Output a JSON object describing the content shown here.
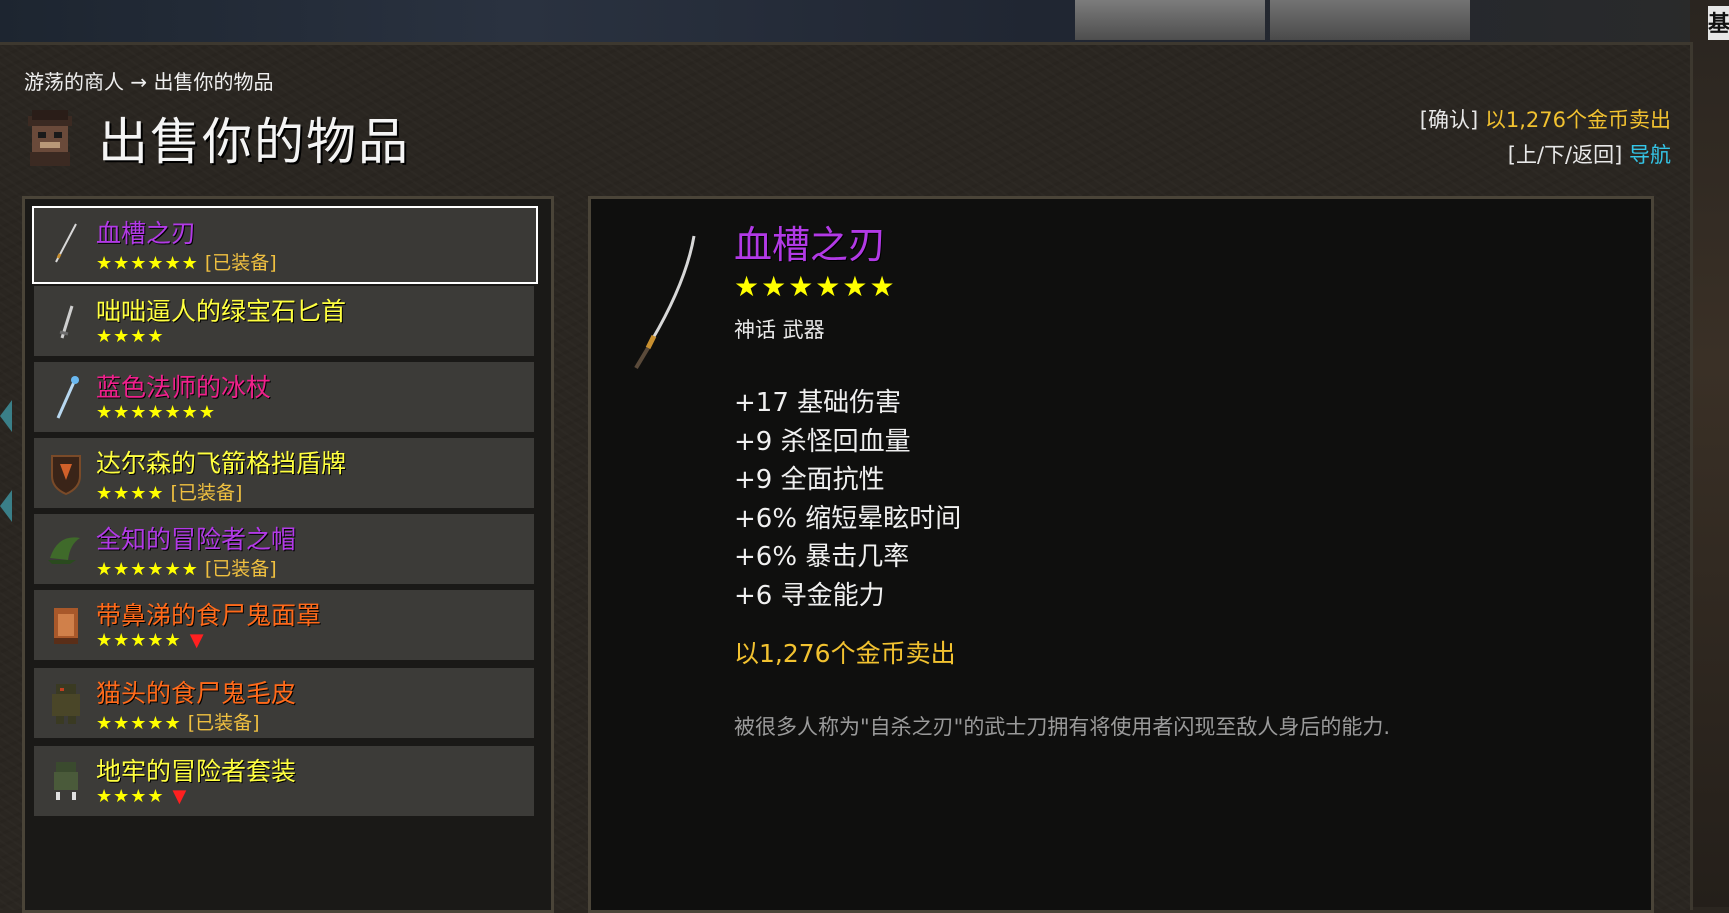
{
  "header": {
    "breadcrumb": "游荡的商人 → 出售你的物品",
    "title": "出售你的物品",
    "corner_text": "基"
  },
  "hints": {
    "confirm_key": "[确认]",
    "confirm_action": "以1,276个金币卖出",
    "nav_key": "[上/下/返回]",
    "nav_action": "导航"
  },
  "items": [
    {
      "name": "血槽之刃",
      "stars": "★★★★★★",
      "tag": "[已装备]",
      "down": "",
      "color": "#b23ae6",
      "icon": "katana-icon"
    },
    {
      "name": "咄咄逼人的绿宝石匕首",
      "stars": "★★★★",
      "tag": "",
      "down": "",
      "color": "#ffff40",
      "icon": "dagger-icon"
    },
    {
      "name": "蓝色法师的冰杖",
      "stars": "★★★★★★★",
      "tag": "",
      "down": "",
      "color": "#f0208c",
      "icon": "staff-icon"
    },
    {
      "name": "达尔森的飞箭格挡盾牌",
      "stars": "★★★★",
      "tag": "[已装备]",
      "down": "",
      "color": "#ffff40",
      "icon": "shield-icon"
    },
    {
      "name": "全知的冒险者之帽",
      "stars": "★★★★★★",
      "tag": "[已装备]",
      "down": "",
      "color": "#b23ae6",
      "icon": "hat-icon"
    },
    {
      "name": "带鼻涕的食尸鬼面罩",
      "stars": "★★★★★",
      "tag": "",
      "down": "▼",
      "color": "#ff6a1a",
      "icon": "mask-icon"
    },
    {
      "name": "猫头的食尸鬼毛皮",
      "stars": "★★★★★",
      "tag": "[已装备]",
      "down": "",
      "color": "#ff6a1a",
      "icon": "fur-armor-icon"
    },
    {
      "name": "地牢的冒险者套装",
      "stars": "★★★★",
      "tag": "",
      "down": "▼",
      "color": "#ffff40",
      "icon": "armor-set-icon"
    }
  ],
  "detail": {
    "name": "血槽之刃",
    "name_color": "#b23ae6",
    "stars": "★★★★★★",
    "type": "神话 武器",
    "stats": [
      "+17 基础伤害",
      "+9 杀怪回血量",
      "+9 全面抗性",
      "+6% 缩短晕眩时间",
      "+6% 暴击几率",
      "+6 寻金能力"
    ],
    "price": "以1,276个金币卖出",
    "description": "被很多人称为\"自杀之刃\"的武士刀拥有将使用者闪现至敌人身后的能力."
  }
}
